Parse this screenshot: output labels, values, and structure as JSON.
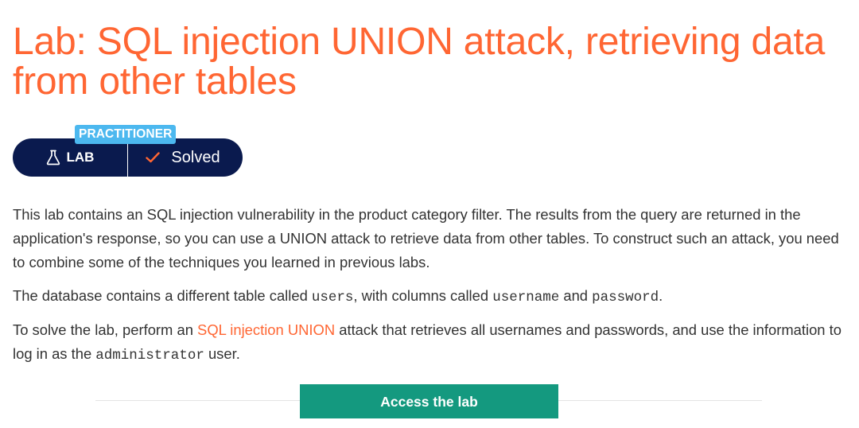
{
  "title": "Lab: SQL injection UNION attack, retrieving data from other tables",
  "badge": {
    "level": "PRACTITIONER",
    "type_label": "LAB",
    "type_icon": "flask-icon",
    "status_label": "Solved",
    "status_icon": "check-icon"
  },
  "description": {
    "p1": "This lab contains an SQL injection vulnerability in the product category filter. The results from the query are returned in the application's response, so you can use a UNION attack to retrieve data from other tables. To construct such an attack, you need to combine some of the techniques you learned in previous labs.",
    "p2": {
      "before": "The database contains a different table called ",
      "code1": "users",
      "middle": ", with columns called ",
      "code2": "username",
      "and": " and ",
      "code3": "password",
      "after": "."
    },
    "p3": {
      "before": "To solve the lab, perform an ",
      "link": "SQL injection UNION",
      "middle": " attack that retrieves all usernames and passwords, and use the information to log in as the ",
      "code": "administrator",
      "after": " user."
    }
  },
  "access_button": "Access the lab",
  "colors": {
    "title": "#ff6633",
    "badge_level_bg": "#4cb8ef",
    "pill_bg": "#0a1a4e",
    "check": "#ff6633",
    "button_bg": "#14997f"
  }
}
